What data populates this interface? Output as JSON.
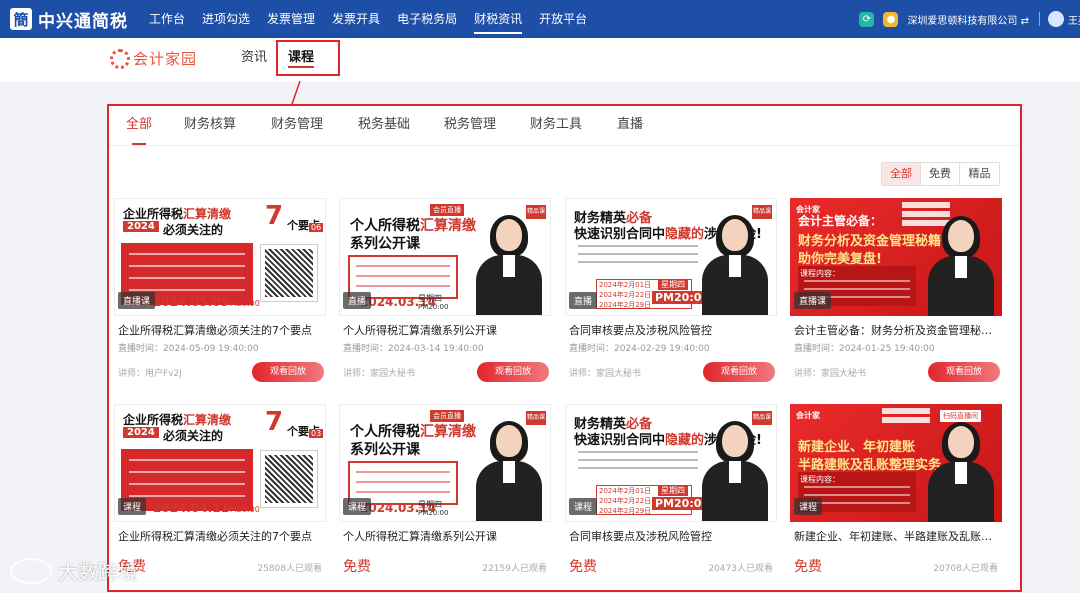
{
  "app": {
    "brand_icon": "簡",
    "brand_name": "中兴通简税"
  },
  "nav": {
    "items": [
      "工作台",
      "进项勾选",
      "发票管理",
      "发票开具",
      "电子税务局",
      "财税资讯",
      "开放平台"
    ],
    "active_index": 5,
    "company": "深圳爱思顿科技有限公司 ⇄",
    "user": "王英"
  },
  "subheader": {
    "logo_text": "会计家园",
    "tabs": [
      "资讯",
      "课程"
    ],
    "active_index": 1
  },
  "categories": {
    "tabs": [
      "全部",
      "财务核算",
      "财务管理",
      "税务基础",
      "税务管理",
      "财务工具",
      "直播"
    ],
    "active_index": 0
  },
  "filters": {
    "options": [
      "全部",
      "免费",
      "精品"
    ],
    "active_index": 0
  },
  "cards_row1": [
    {
      "variant": "v1",
      "thumb_num": "06",
      "thumb_date": "2024.05.09",
      "thumb_time": "PM20:00",
      "tag": "直播课",
      "title": "企业所得税汇算清缴必须关注的7个要点",
      "time": "直播时间：2024-05-09 19:40:00",
      "lecturer": "讲师：用户Fv2J",
      "action": "观看回放"
    },
    {
      "variant": "v2",
      "thumb_date": "2024.03.14",
      "thumb_week": "星期四",
      "thumb_time": "PM20:00",
      "tag": "直播",
      "title": "个人所得税汇算清缴系列公开课",
      "time": "直播时间：2024-03-14 19:40:00",
      "lecturer": "讲师：家园大秘书",
      "action": "观看回放"
    },
    {
      "variant": "v3",
      "thumb_dates": "2024年2月01日\n2024年2月22日\n2024年2月29日",
      "thumb_week": "星期四",
      "thumb_time": "PM20:00",
      "tag": "直播",
      "title": "合同审核要点及涉税风险管控",
      "time": "直播时间：2024-02-29 19:40:00",
      "lecturer": "讲师：家园大秘书",
      "action": "观看回放"
    },
    {
      "variant": "v4",
      "tag": "直播课",
      "title": "会计主管必备：财务分析及资金管理秘籍（已完结）",
      "time": "直播时间：2024-01-25 19:40:00",
      "lecturer": "讲师：家园大秘书",
      "action": "观看回放"
    }
  ],
  "cards_row2": [
    {
      "variant": "v1",
      "thumb_num": "03",
      "thumb_date": "2024.04.11",
      "thumb_time": "PM20:00",
      "tag": "课程",
      "title": "企业所得税汇算清缴必须关注的7个要点",
      "free": "免费",
      "views": "25808人已观看"
    },
    {
      "variant": "v2",
      "thumb_date": "2024.03.14",
      "thumb_week": "星期四",
      "thumb_time": "PM20:00",
      "tag": "课程",
      "title": "个人所得税汇算清缴系列公开课",
      "free": "免费",
      "views": "22159人已观看"
    },
    {
      "variant": "v3",
      "thumb_dates": "2024年2月01日\n2024年2月22日\n2024年2月29日",
      "thumb_week": "星期四",
      "thumb_time": "PM20:00",
      "tag": "课程",
      "title": "合同审核要点及涉税风险管控",
      "free": "免费",
      "views": "20473人已观看"
    },
    {
      "variant": "v5",
      "tag": "课程",
      "title": "新建企业、年初建账、半路建账及乱账整理实务",
      "free": "免费",
      "views": "20708人已观看"
    }
  ],
  "thumb_text": {
    "v1_line1a": "企业所得税",
    "v1_line1b": "汇算清缴",
    "v1_big": "7",
    "v1_yaodian": "个要点",
    "v1_year": "2024",
    "v1_line2": "必须关注的",
    "v2_badge": "会员直播",
    "v2_logo": "精品课",
    "v2_line1a": "个人所得税",
    "v2_line1b": "汇算清缴",
    "v2_line2": "系列公开课",
    "v3_line1a": "财务精英",
    "v3_line1b": "必备",
    "v3_line2a": "快速识别合同中",
    "v3_line2b": "隐藏的",
    "v3_line2c": "涉税风险!",
    "v4_logo": "会计家",
    "v4_line1": "会计主管必备：",
    "v4_line2": "财务分析及资金管理秘籍",
    "v4_line3": "助你完美复盘!",
    "v4_content": "课程内容：",
    "v5_logo": "会计家",
    "v5_live": "扫码直播间",
    "v5_line1": "新建企业、年初建账",
    "v5_line2": "半路建账及乱账整理实务",
    "v5_content": "课程内容："
  },
  "watermark": {
    "text": "大数跨境"
  },
  "colors": {
    "nav_bg": "#1e4fa6",
    "accent_red": "#d0392e",
    "highlight_box": "#e0242a",
    "page_bg": "#f1f3f6"
  }
}
